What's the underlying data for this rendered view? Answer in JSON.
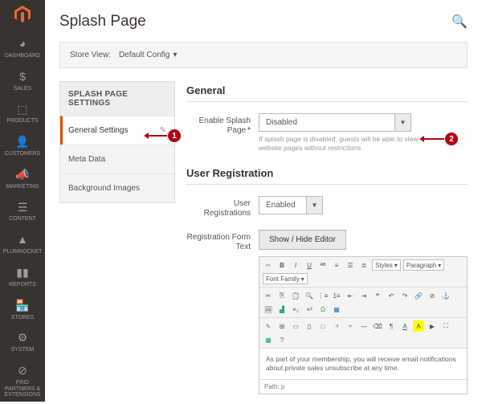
{
  "sidebar": {
    "items": [
      {
        "label": "DASHBOARD"
      },
      {
        "label": "SALES"
      },
      {
        "label": "PRODUCTS"
      },
      {
        "label": "CUSTOMERS"
      },
      {
        "label": "MARKETING"
      },
      {
        "label": "CONTENT"
      },
      {
        "label": "PLUMROCKET"
      },
      {
        "label": "REPORTS"
      },
      {
        "label": "STORES"
      },
      {
        "label": "SYSTEM"
      },
      {
        "label": "FIND PARTNERS & EXTENSIONS"
      }
    ]
  },
  "header": {
    "title": "Splash Page"
  },
  "storeview": {
    "label": "Store View:",
    "value": "Default Config"
  },
  "tabs": {
    "title": "SPLASH PAGE SETTINGS",
    "items": [
      {
        "label": "General Settings"
      },
      {
        "label": "Meta Data"
      },
      {
        "label": "Background Images"
      }
    ]
  },
  "sections": {
    "general": {
      "title": "General",
      "enable_label": "Enable Splash Page",
      "enable_value": "Disabled",
      "enable_help": "If splash page is disabled, guests will be able to view website pages without restrictions"
    },
    "userreg": {
      "title": "User Registration",
      "reg_label": "User Registrations",
      "reg_value": "Enabled",
      "form_label": "Registration Form Text",
      "toggle_btn": "Show / Hide Editor",
      "editor_body": "As part of your membership, you will receive email notifications about private sales unsubscribe at any time.",
      "path_label": "Path: p",
      "toolbar_selects": {
        "styles": "Styles",
        "paragraph": "Paragraph",
        "fontfamily": "Font Family"
      }
    }
  },
  "annotations": {
    "a1": "1",
    "a2": "2"
  }
}
